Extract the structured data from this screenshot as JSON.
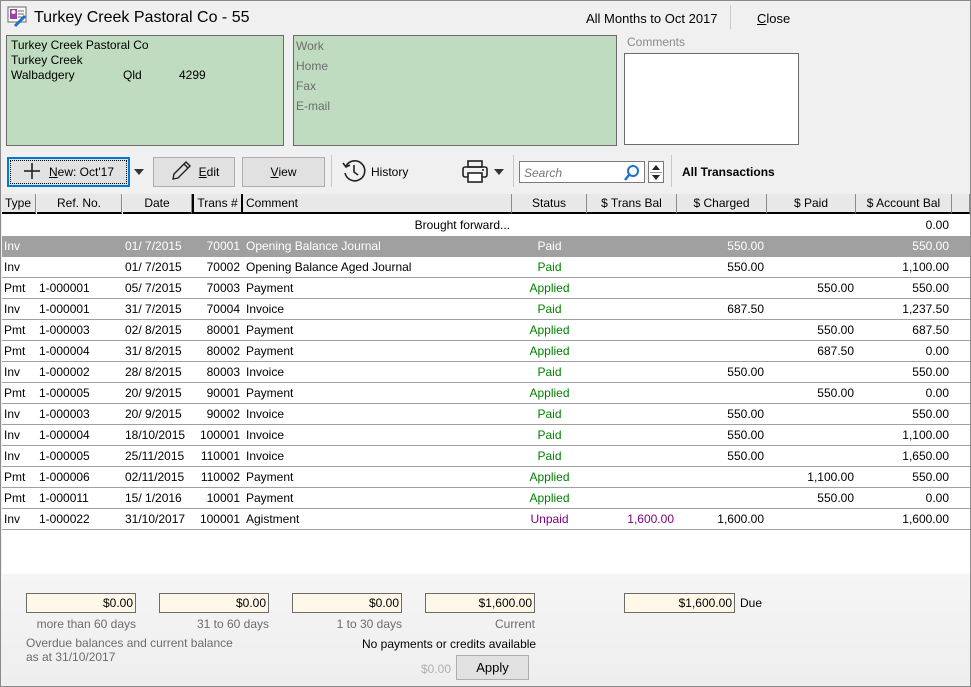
{
  "window": {
    "title": "Turkey Creek Pastoral Co - 55",
    "period": "All Months to Oct 2017",
    "close_label": "Close",
    "close_accel": "C",
    "close_rest": "lose"
  },
  "address": {
    "name": "Turkey Creek Pastoral Co",
    "line2": "Turkey Creek",
    "town": "Walbadgery",
    "state": "Qld",
    "postcode": "4299"
  },
  "contact": {
    "labels": [
      "Work",
      "Home",
      "Fax",
      "E-mail"
    ]
  },
  "comments": {
    "label": "Comments",
    "value": ""
  },
  "toolbar": {
    "new_accel": "N",
    "new_rest": "ew: Oct'17",
    "edit_accel": "E",
    "edit_rest": "dit",
    "view_accel": "V",
    "view_rest": "iew",
    "history_label": "History",
    "search_placeholder": "Search",
    "filter_label": "All Transactions"
  },
  "grid": {
    "columns": [
      "Type",
      "Ref. No.",
      "Date",
      "Trans #",
      "Comment",
      "Status",
      "$ Trans Bal",
      "$ Charged",
      "$ Paid",
      "$ Account Bal"
    ],
    "brought_forward": {
      "label": "Brought forward...",
      "account_bal": "0.00"
    },
    "rows": [
      {
        "type": "Inv",
        "ref": "",
        "date": "01/ 7/2015",
        "trans": "70001",
        "comment": "Opening Balance Journal",
        "status": "Paid",
        "trans_bal": "",
        "charged": "550.00",
        "paid": "",
        "account_bal": "550.00",
        "selected": true
      },
      {
        "type": "Inv",
        "ref": "",
        "date": "01/ 7/2015",
        "trans": "70002",
        "comment": "Opening Balance Aged Journal",
        "status": "Paid",
        "trans_bal": "",
        "charged": "550.00",
        "paid": "",
        "account_bal": "1,100.00"
      },
      {
        "type": "Pmt",
        "ref": "1-000001",
        "date": "05/ 7/2015",
        "trans": "70003",
        "comment": "Payment",
        "status": "Applied",
        "trans_bal": "",
        "charged": "",
        "paid": "550.00",
        "account_bal": "550.00"
      },
      {
        "type": "Inv",
        "ref": "1-000001",
        "date": "31/ 7/2015",
        "trans": "70004",
        "comment": "Invoice",
        "status": "Paid",
        "trans_bal": "",
        "charged": "687.50",
        "paid": "",
        "account_bal": "1,237.50"
      },
      {
        "type": "Pmt",
        "ref": "1-000003",
        "date": "02/ 8/2015",
        "trans": "80001",
        "comment": "Payment",
        "status": "Applied",
        "trans_bal": "",
        "charged": "",
        "paid": "550.00",
        "account_bal": "687.50"
      },
      {
        "type": "Pmt",
        "ref": "1-000004",
        "date": "31/ 8/2015",
        "trans": "80002",
        "comment": "Payment",
        "status": "Applied",
        "trans_bal": "",
        "charged": "",
        "paid": "687.50",
        "account_bal": "0.00"
      },
      {
        "type": "Inv",
        "ref": "1-000002",
        "date": "28/ 8/2015",
        "trans": "80003",
        "comment": "Invoice",
        "status": "Paid",
        "trans_bal": "",
        "charged": "550.00",
        "paid": "",
        "account_bal": "550.00"
      },
      {
        "type": "Pmt",
        "ref": "1-000005",
        "date": "20/ 9/2015",
        "trans": "90001",
        "comment": "Payment",
        "status": "Applied",
        "trans_bal": "",
        "charged": "",
        "paid": "550.00",
        "account_bal": "0.00"
      },
      {
        "type": "Inv",
        "ref": "1-000003",
        "date": "20/ 9/2015",
        "trans": "90002",
        "comment": "Invoice",
        "status": "Paid",
        "trans_bal": "",
        "charged": "550.00",
        "paid": "",
        "account_bal": "550.00"
      },
      {
        "type": "Inv",
        "ref": "1-000004",
        "date": "18/10/2015",
        "trans": "100001",
        "comment": "Invoice",
        "status": "Paid",
        "trans_bal": "",
        "charged": "550.00",
        "paid": "",
        "account_bal": "1,100.00"
      },
      {
        "type": "Inv",
        "ref": "1-000005",
        "date": "25/11/2015",
        "trans": "110001",
        "comment": "Invoice",
        "status": "Paid",
        "trans_bal": "",
        "charged": "550.00",
        "paid": "",
        "account_bal": "1,650.00"
      },
      {
        "type": "Pmt",
        "ref": "1-000006",
        "date": "02/11/2015",
        "trans": "110002",
        "comment": "Payment",
        "status": "Applied",
        "trans_bal": "",
        "charged": "",
        "paid": "1,100.00",
        "account_bal": "550.00"
      },
      {
        "type": "Pmt",
        "ref": "1-000011",
        "date": "15/ 1/2016",
        "trans": "10001",
        "comment": "Payment",
        "status": "Applied",
        "trans_bal": "",
        "charged": "",
        "paid": "550.00",
        "account_bal": "0.00"
      },
      {
        "type": "Inv",
        "ref": "1-000022",
        "date": "31/10/2017",
        "trans": "100001",
        "comment": "Agistment",
        "status": "Unpaid",
        "trans_bal": "1,600.00",
        "charged": "1,600.00",
        "paid": "",
        "account_bal": "1,600.00"
      }
    ]
  },
  "aging": {
    "over60": "$0.00",
    "over60_label": "more than 60 days",
    "d31_60": "$0.00",
    "d31_60_label": "31 to 60 days",
    "d1_30": "$0.00",
    "d1_30_label": "1 to 30 days",
    "current": "$1,600.00",
    "current_label": "Current",
    "due": "$1,600.00",
    "due_label": "Due",
    "note_line1": "Overdue balances and current balance",
    "note_line2": "as at 31/10/2017",
    "credits_text": "No payments or credits available",
    "credit_amount": "$0.00",
    "apply_label": "Apply"
  },
  "colors": {
    "panel_green": "#c0dcc0",
    "status_paid": "#008000",
    "status_unpaid": "#800080",
    "selected_row": "#a0a0a0",
    "focus_blue": "#0078d7"
  }
}
